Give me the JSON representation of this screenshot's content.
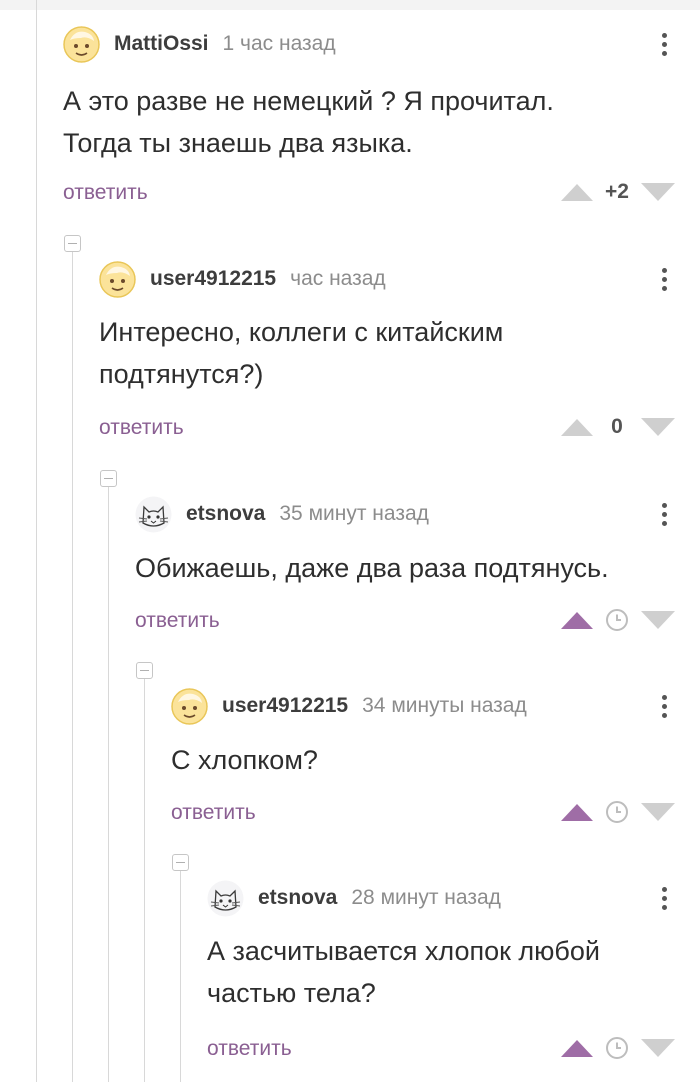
{
  "comments": [
    {
      "username": "MattiOssi",
      "time": "1 час назад",
      "text": "А это разве не немецкий ? Я прочитал.\nТогда ты знаешь два языка.",
      "reply_label": "ответить",
      "rating": "+2",
      "upvoted": false,
      "avatar_icon": "smiley-avatar-icon"
    },
    {
      "username": "user4912215",
      "time": "час назад",
      "text": "Интересно, коллеги с китайским\nподтянутся?)",
      "reply_label": "ответить",
      "rating": "0",
      "upvoted": false,
      "avatar_icon": "smiley-avatar-icon"
    },
    {
      "username": "etsnova",
      "time": "35 минут назад",
      "text": "Обижаешь, даже два раза подтянусь.",
      "reply_label": "ответить",
      "rating": null,
      "upvoted": true,
      "avatar_icon": "cat-sketch-avatar-icon"
    },
    {
      "username": "user4912215",
      "time": "34 минуты назад",
      "text": "С хлопком?",
      "reply_label": "ответить",
      "rating": null,
      "upvoted": true,
      "avatar_icon": "smiley-avatar-icon"
    },
    {
      "username": "etsnova",
      "time": "28 минут назад",
      "text": "А засчитывается хлопок любой\nчастью тела?",
      "reply_label": "ответить",
      "rating": null,
      "upvoted": true,
      "avatar_icon": "cat-sketch-avatar-icon"
    }
  ],
  "colors": {
    "accent": "#9f6da6",
    "vote_inactive": "#cfcfcf",
    "reply_link": "#8a5f92"
  }
}
